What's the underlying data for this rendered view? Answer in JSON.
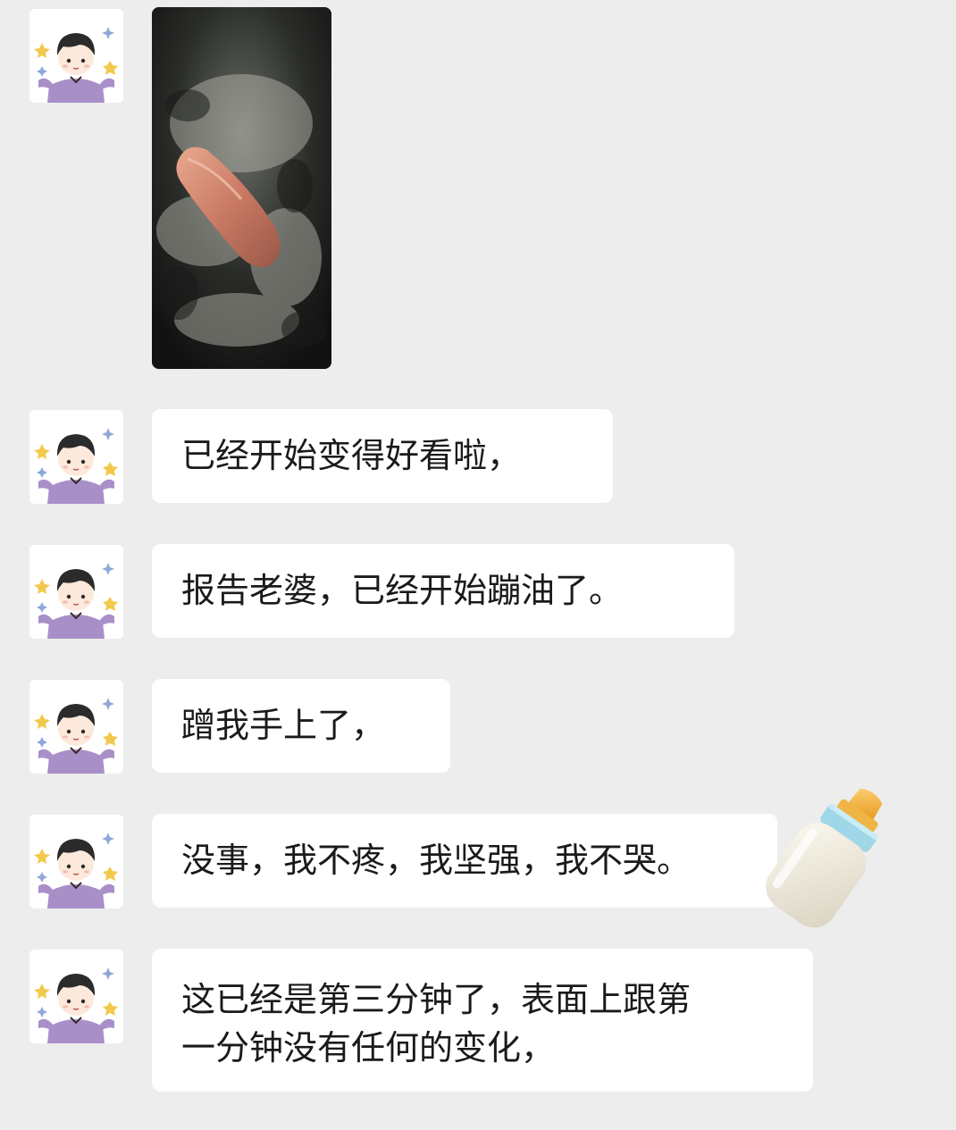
{
  "conversation": {
    "messages": [
      {
        "type": "image",
        "image_alt": "sausage-in-pan-photo"
      },
      {
        "type": "text",
        "text": "已经开始变得好看啦，"
      },
      {
        "type": "text",
        "text": "报告老婆，已经开始蹦油了。"
      },
      {
        "type": "text",
        "text": "蹭我手上了，"
      },
      {
        "type": "text",
        "text": "没事，我不疼，我坚强，我不哭。"
      },
      {
        "type": "text",
        "lines": [
          "这已经是第三分钟了，表面上跟第",
          "一分钟没有任何的变化，"
        ]
      }
    ],
    "sticker": "baby-bottle-icon"
  },
  "colors": {
    "background": "#ededed",
    "bubble": "#ffffff",
    "text": "#1a1a1a",
    "avatar_shirt": "#a98fc8",
    "avatar_star": "#f2c94c"
  }
}
